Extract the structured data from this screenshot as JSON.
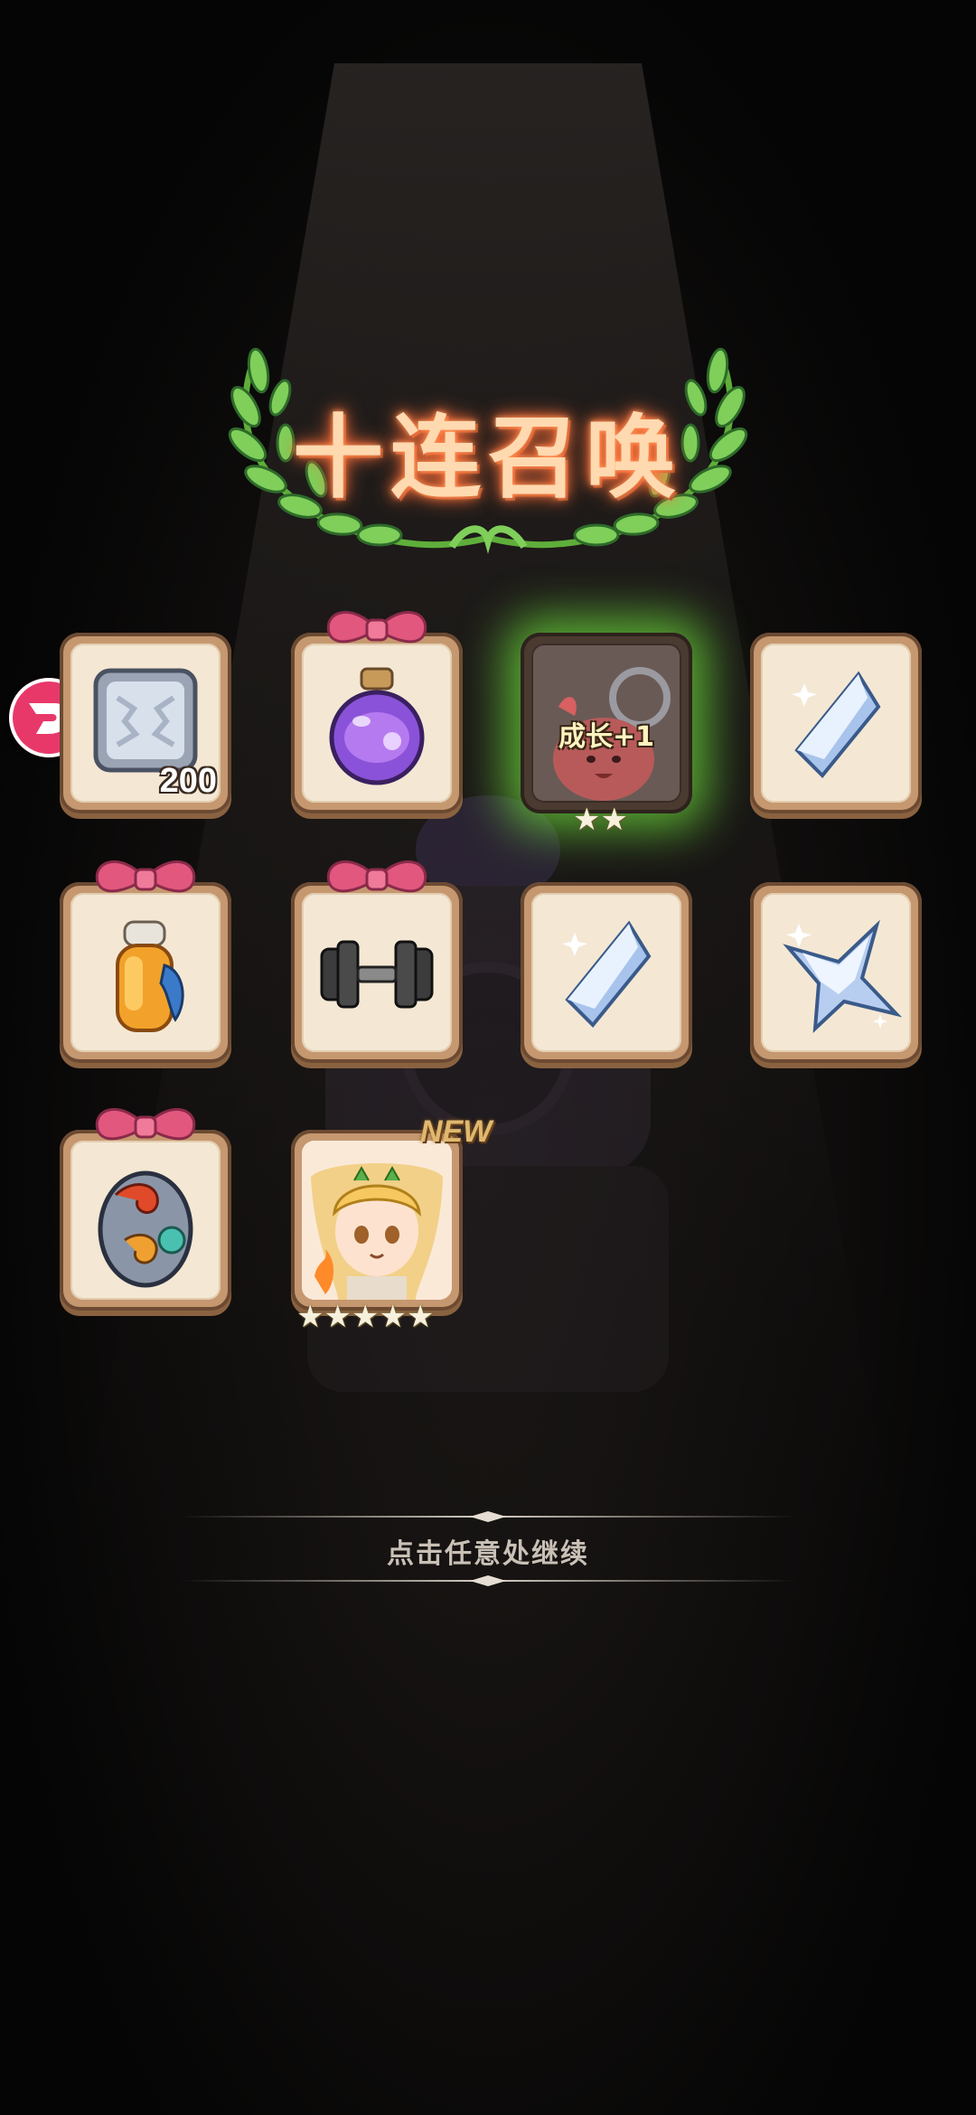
{
  "screen": {
    "title": "十连召唤",
    "continue_hint": "点击任意处继续"
  },
  "rewards": [
    {
      "name": "white-cube",
      "quantity": "200",
      "gift": false
    },
    {
      "name": "purple-potion",
      "gift": true
    },
    {
      "name": "growth-card",
      "label": "成长+1",
      "stars": 2,
      "highlighted": true
    },
    {
      "name": "white-crystal",
      "gift": false
    },
    {
      "name": "orange-elixir",
      "gift": true
    },
    {
      "name": "dumbbell",
      "gift": true
    },
    {
      "name": "white-crystal",
      "gift": false
    },
    {
      "name": "white-star-crystal",
      "gift": false
    },
    {
      "name": "dragon-egg",
      "gift": true
    },
    {
      "name": "elf-hero-portrait",
      "badge": "NEW",
      "stars": 5,
      "gift": false
    }
  ],
  "colors": {
    "card_frame": "#c69870",
    "card_face": "#f4e8d4",
    "bow": "#e2577e",
    "highlight_glow": "#6edc3c",
    "title_glow": "#ff6f3a",
    "side_badge": "#e8386a"
  },
  "icons": {
    "side_badge": "d-logo-icon",
    "star": "star-icon"
  }
}
